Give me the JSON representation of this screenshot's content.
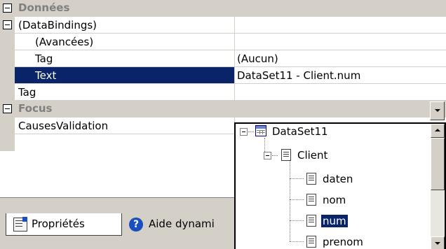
{
  "grid": {
    "categories": {
      "data": {
        "label": "Données"
      },
      "focus": {
        "label": "Focus"
      }
    },
    "rows": {
      "databindings": {
        "name": "(DataBindings)",
        "value": ""
      },
      "advanced": {
        "name": "(Avancées)",
        "value": ""
      },
      "tag_binding": {
        "name": "Tag",
        "value": "(Aucun)"
      },
      "text_binding": {
        "name": "Text",
        "value": "DataSet11 - Client.num"
      },
      "tag": {
        "name": "Tag",
        "value": ""
      },
      "causes_validation": {
        "name": "CausesValidation",
        "value": ""
      }
    }
  },
  "popup": {
    "dataset": "DataSet11",
    "table": "Client",
    "columns": [
      "daten",
      "nom",
      "num",
      "prenom"
    ],
    "selected_column": "num"
  },
  "tabs": {
    "properties": "Propriétés",
    "dynamic_help": "Aide dynami",
    "help_glyph": "?"
  },
  "colors": {
    "selection": "#0a246a",
    "category_text": "#808080",
    "face": "#d4d0c8"
  }
}
